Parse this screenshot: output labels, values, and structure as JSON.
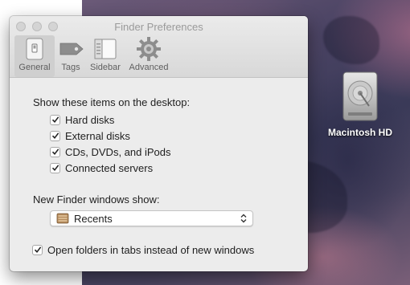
{
  "window": {
    "title": "Finder Preferences"
  },
  "toolbar": {
    "tabs": [
      {
        "label": "General",
        "icon": "general-icon",
        "selected": true
      },
      {
        "label": "Tags",
        "icon": "tag-icon",
        "selected": false
      },
      {
        "label": "Sidebar",
        "icon": "sidebar-icon",
        "selected": false
      },
      {
        "label": "Advanced",
        "icon": "gear-icon",
        "selected": false
      }
    ]
  },
  "desktop_section": {
    "heading": "Show these items on the desktop:",
    "items": [
      {
        "label": "Hard disks",
        "checked": true
      },
      {
        "label": "External disks",
        "checked": true
      },
      {
        "label": "CDs, DVDs, and iPods",
        "checked": true
      },
      {
        "label": "Connected servers",
        "checked": true
      }
    ]
  },
  "new_window_section": {
    "heading": "New Finder windows show:",
    "selected_option": "Recents"
  },
  "tabs_option": {
    "label": "Open folders in tabs instead of new windows",
    "checked": true
  },
  "desktop_icon": {
    "label": "Macintosh HD",
    "icon": "hard-drive-icon"
  }
}
